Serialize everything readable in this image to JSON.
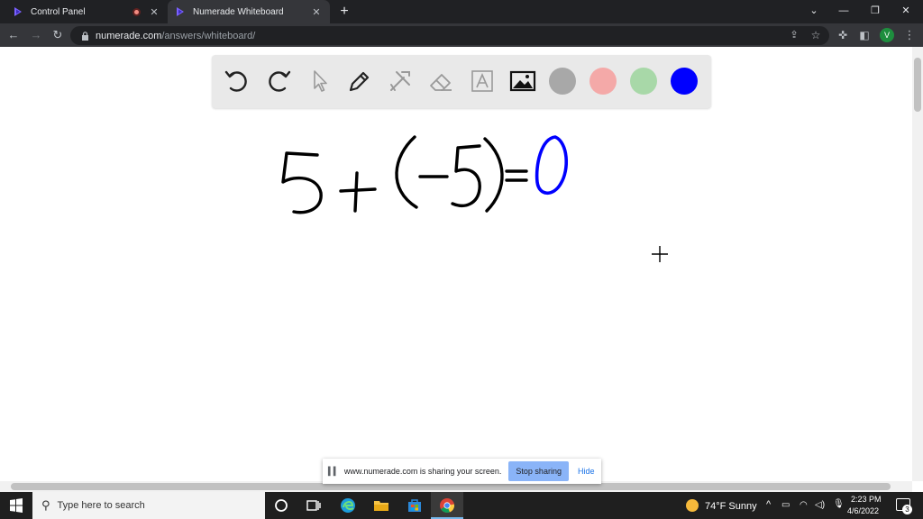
{
  "browser": {
    "tabs": [
      {
        "title": "Control Panel",
        "recording": true
      },
      {
        "title": "Numerade Whiteboard",
        "active": true
      }
    ],
    "url_host": "numerade.com",
    "url_path": "/answers/whiteboard/",
    "profile_initial": "V"
  },
  "whiteboard": {
    "tools": [
      "undo-icon",
      "redo-icon",
      "pointer-icon",
      "pen-icon",
      "tools-icon",
      "eraser-icon",
      "text-icon",
      "image-icon"
    ],
    "colors": [
      "#a8a8a8",
      "#f4a9a8",
      "#a8d8a8",
      "#0000ff"
    ],
    "equation": "5+(-5)=0",
    "ink_color": "#000000",
    "answer_color": "#0000ff"
  },
  "share_banner": {
    "message": "www.numerade.com is sharing your screen.",
    "stop_label": "Stop sharing",
    "hide_label": "Hide"
  },
  "taskbar": {
    "search_placeholder": "Type here to search",
    "weather": "74°F  Sunny",
    "time": "2:23 PM",
    "date": "4/6/2022",
    "notification_count": "3"
  }
}
